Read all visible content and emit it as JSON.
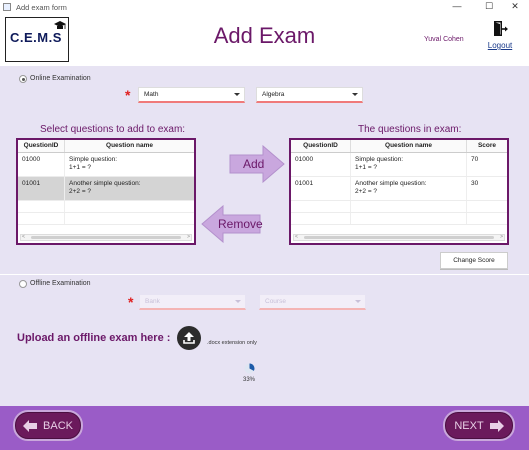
{
  "window": {
    "title": "Add exam form",
    "minimize": "—",
    "maximize": "☐",
    "close": "✕"
  },
  "header": {
    "logo_text": "C.E.M.S",
    "title": "Add Exam",
    "user_name": "Yuval Cohen",
    "logout_label": "Logout"
  },
  "online": {
    "label": "Online Examination",
    "selected": true,
    "subject": {
      "value": "Math"
    },
    "course": {
      "value": "Algebra"
    }
  },
  "left_table": {
    "title": "Select questions to add to exam:",
    "columns": [
      "QuestionID",
      "Question name"
    ],
    "rows": [
      {
        "id": "01000",
        "name_line1": "Simple question:",
        "name_line2": "1+1 = ?"
      },
      {
        "id": "01001",
        "name_line1": "Another simple question:",
        "name_line2": "2+2 = ?"
      }
    ]
  },
  "right_table": {
    "title": "The questions in exam:",
    "columns": [
      "QuestionID",
      "Question name",
      "Score"
    ],
    "rows": [
      {
        "id": "01000",
        "name_line1": "Simple question:",
        "name_line2": "1+1 = ?",
        "score": "70"
      },
      {
        "id": "01001",
        "name_line1": "Another simple question:",
        "name_line2": "2+2 = ?",
        "score": "30"
      }
    ]
  },
  "buttons": {
    "add": "Add",
    "remove": "Remove",
    "change_score": "Change Score",
    "back": "BACK",
    "next": "NEXT"
  },
  "offline": {
    "label": "Offline Examination",
    "selected": false,
    "subject_placeholder": "Bank",
    "course_placeholder": "Course",
    "upload_label": "Upload an offline exam here :",
    "extension_hint": ".docx extension only",
    "progress_percent": 33,
    "progress_label": "33%"
  },
  "colors": {
    "accent": "#6b1868",
    "panel": "#e7e3f3",
    "footer": "#9a5cc7",
    "required": "#e02020"
  },
  "icons": {
    "logout": "door-exit-icon",
    "upload": "upload-icon",
    "back": "arrow-left-icon",
    "next": "arrow-right-icon"
  }
}
